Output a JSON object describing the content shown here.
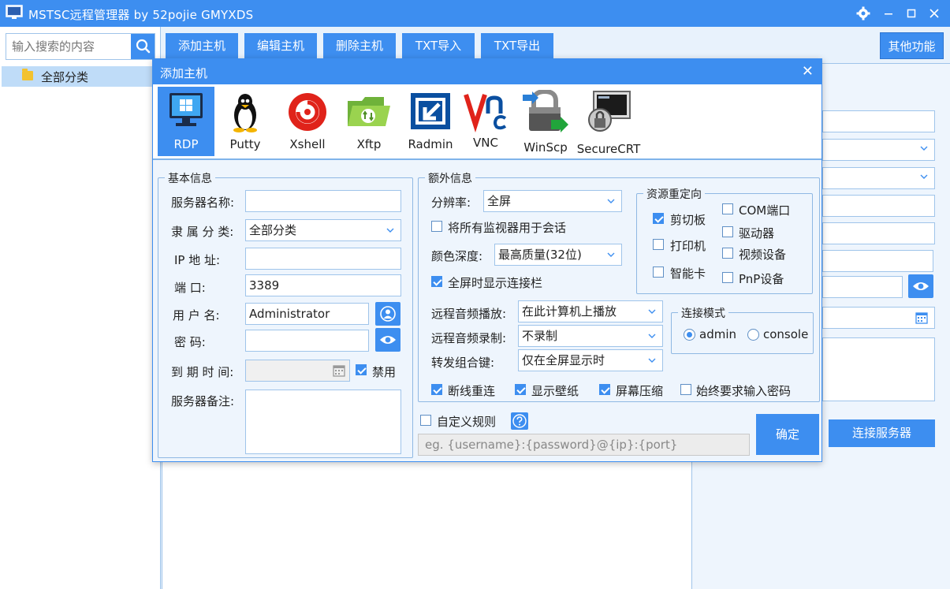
{
  "window": {
    "title": "MSTSC远程管理器 by 52pojie GMYXDS"
  },
  "sidebar": {
    "search_placeholder": "输入搜索的内容",
    "tree": [
      {
        "label": "全部分类"
      }
    ]
  },
  "toolbar": {
    "tabs": [
      {
        "label": "添加主机"
      },
      {
        "label": "编辑主机"
      },
      {
        "label": "删除主机"
      },
      {
        "label": "TXT导入"
      },
      {
        "label": "TXT导出"
      }
    ],
    "other_label": "其他功能"
  },
  "background": {
    "connect_label": "连接服务器"
  },
  "dialog": {
    "title": "添加主机",
    "protocols": [
      {
        "label": "RDP",
        "icon": "rdp-monitor-icon",
        "active": true
      },
      {
        "label": "Putty",
        "icon": "putty-penguin-icon"
      },
      {
        "label": "Xshell",
        "icon": "xshell-icon"
      },
      {
        "label": "Xftp",
        "icon": "xftp-folder-icon"
      },
      {
        "label": "Radmin",
        "icon": "radmin-icon"
      },
      {
        "label": "VNC",
        "icon": "vnc-icon"
      },
      {
        "label": "WinScp",
        "icon": "winscp-lock-icon"
      },
      {
        "label": "SecureCRT",
        "icon": "securecrt-icon"
      }
    ],
    "basic": {
      "title": "基本信息",
      "server_name_label": "服务器名称:",
      "server_name_value": "",
      "category_label": "隶 属 分 类:",
      "category_value": "全部分类",
      "ip_label": "IP    地    址:",
      "ip_value": "",
      "port_label": "端          口:",
      "port_value": "3389",
      "user_label": "用    户    名:",
      "user_value": "Administrator",
      "password_label": "密          码:",
      "password_value": "",
      "expire_label": "到 期 时 间:",
      "expire_value": "",
      "disable_label": "禁用",
      "disable_checked": true,
      "note_label": "服务器备注:",
      "note_value": ""
    },
    "extra": {
      "title": "额外信息",
      "resolution_label": "分辨率:",
      "resolution_value": "全屏",
      "all_monitors_label": "将所有监视器用于会话",
      "color_depth_label": "颜色深度:",
      "color_depth_value": "最高质量(32位)",
      "fullscreen_bar_label": "全屏时显示连接栏",
      "audio_play_label": "远程音频播放:",
      "audio_play_value": "在此计算机上播放",
      "audio_rec_label": "远程音频录制:",
      "audio_rec_value": "不录制",
      "hotkey_label": "转发组合键:",
      "hotkey_value": "仅在全屏显示时",
      "reconnect_label": "断线重连",
      "wallpaper_label": "显示壁纸",
      "compress_label": "屏幕压缩",
      "always_pwd_label": "始终要求输入密码"
    },
    "redirect": {
      "title": "资源重定向",
      "clipboard": "剪切板",
      "com": "COM端口",
      "printer": "打印机",
      "drive": "驱动器",
      "video": "视频设备",
      "smartcard": "智能卡",
      "pnp": "PnP设备"
    },
    "mode": {
      "title": "连接模式",
      "admin": "admin",
      "console": "console"
    },
    "custom_rule_label": "自定义规则",
    "custom_rule_placeholder": "eg. {username}:{password}@{ip}:{port}",
    "ok_label": "确定"
  },
  "colors": {
    "accent": "#3d8ef0",
    "border": "#9fc4ea",
    "panel": "#eef5fd"
  }
}
